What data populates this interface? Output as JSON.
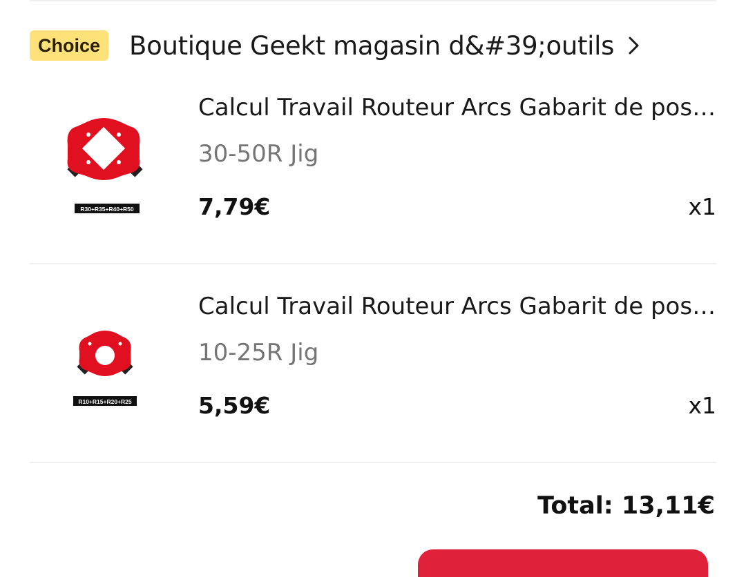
{
  "store": {
    "badge": "Choice",
    "name": "Boutique Geekt magasin d&#39;outils"
  },
  "products": [
    {
      "title": "Calcul Travail Routeur Arcs Gabarit de positionnement pour angles de coin",
      "variant": "30-50R Jig",
      "price": "7,79€",
      "quantity": "x1",
      "image_caption": "R30+R35+R40+R50",
      "image_color": "#e01020"
    },
    {
      "title": "Calcul Travail Routeur Arcs Gabarit de positionnement pour angles de coin",
      "variant": "10-25R Jig",
      "price": "5,59€",
      "quantity": "x1",
      "image_caption": "R10+R15+R20+R25",
      "image_color": "#e01020"
    }
  ],
  "summary": {
    "total": "Total: 13,11€"
  },
  "colors": {
    "badge_bg": "#fde27a",
    "accent": "#e0213a"
  }
}
